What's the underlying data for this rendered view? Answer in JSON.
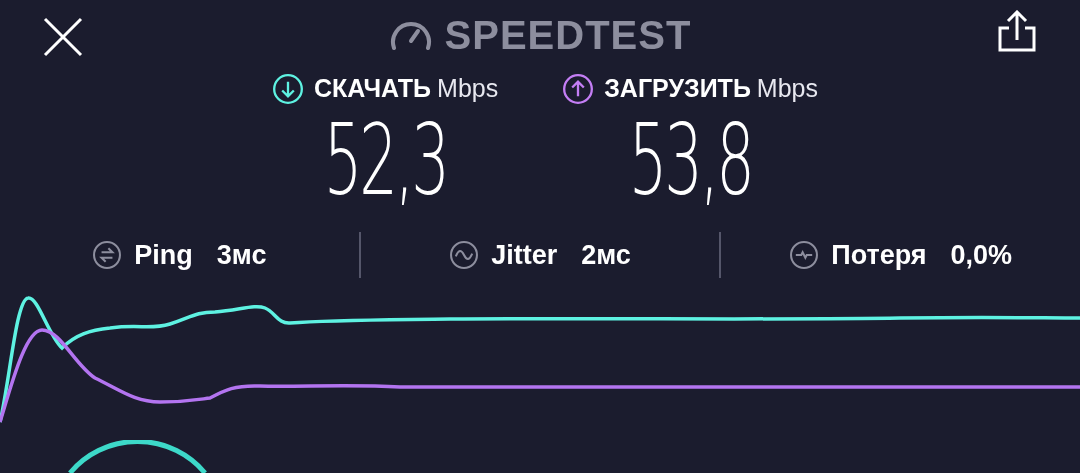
{
  "header": {
    "title": "SPEEDTEST"
  },
  "metrics": [
    {
      "kind": "download",
      "label": "СКАЧАТЬ",
      "unit": "Mbps",
      "value": "52,3"
    },
    {
      "kind": "upload",
      "label": "ЗАГРУЗИТЬ",
      "unit": "Mbps",
      "value": "53,8"
    }
  ],
  "stats": [
    {
      "kind": "ping",
      "label": "Ping",
      "value": "3мс"
    },
    {
      "kind": "jitter",
      "label": "Jitter",
      "value": "2мс"
    },
    {
      "kind": "loss",
      "label": "Потеря",
      "value": "0,0%"
    }
  ]
}
